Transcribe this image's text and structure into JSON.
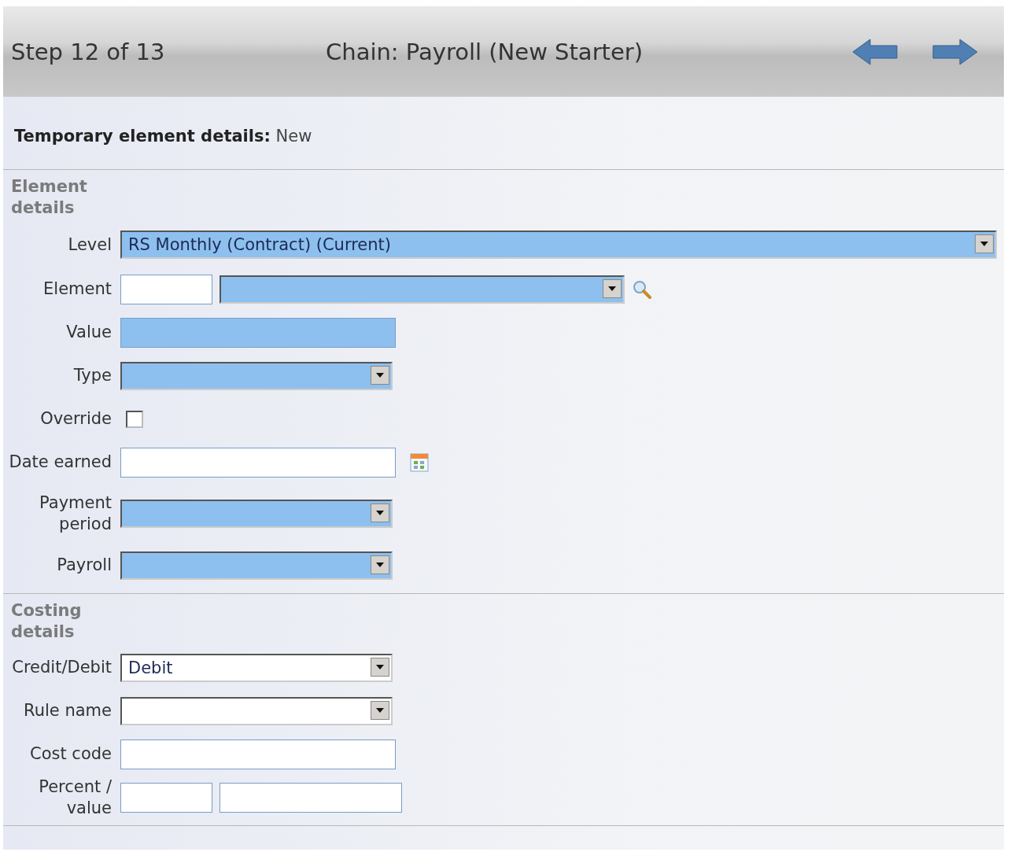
{
  "header": {
    "step": "Step 12 of 13",
    "chain": "Chain: Payroll (New Starter)"
  },
  "record": {
    "label": "Temporary element details:",
    "value": "New"
  },
  "sections": [
    {
      "title": "Element details",
      "fields": [
        {
          "kind": "wide-select",
          "label": "Level",
          "value": "RS Monthly (Contract) (Current)",
          "required": true
        },
        {
          "kind": "lookup",
          "label": "Element",
          "required": true
        },
        {
          "kind": "text",
          "label": "Value",
          "required": true
        },
        {
          "kind": "select",
          "label": "Type",
          "required": true
        },
        {
          "kind": "checkbox",
          "label": "Override",
          "checked": false
        },
        {
          "kind": "date",
          "label": "Date earned",
          "required": false
        },
        {
          "kind": "select",
          "label": "Payment period",
          "required": true
        },
        {
          "kind": "select",
          "label": "Payroll",
          "required": true
        }
      ]
    },
    {
      "title": "Costing details",
      "fields": [
        {
          "kind": "select",
          "label": "Credit/Debit",
          "value": "Debit",
          "required": false
        },
        {
          "kind": "select",
          "label": "Rule name",
          "required": false
        },
        {
          "kind": "text",
          "label": "Cost code",
          "required": false
        },
        {
          "kind": "pair",
          "label": "Percent / value",
          "required": false
        }
      ]
    }
  ]
}
